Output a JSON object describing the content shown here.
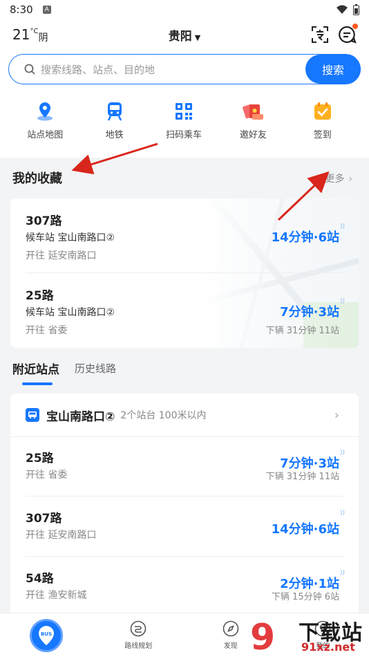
{
  "status": {
    "time": "8:30",
    "notif_glyph": "A"
  },
  "header": {
    "temp": "21",
    "unit": "°C",
    "condition": "阴",
    "city": "贵阳",
    "city_caret": "▼"
  },
  "search": {
    "placeholder": "搜索线路、站点、目的地",
    "button": "搜索"
  },
  "quick": [
    {
      "label": "站点地图",
      "icon": "map-pin-icon"
    },
    {
      "label": "地铁",
      "icon": "metro-icon"
    },
    {
      "label": "扫码乘车",
      "icon": "qr-code-icon"
    },
    {
      "label": "邀好友",
      "icon": "red-envelope-icon"
    },
    {
      "label": "签到",
      "icon": "checkin-icon"
    }
  ],
  "favorites": {
    "title": "我的收藏",
    "more": "更多",
    "more_chev": "›",
    "items": [
      {
        "route": "307路",
        "stop": "候车站 宝山南路口②",
        "direction": "开往 延安南路口",
        "eta": "14分钟·6站",
        "sub": ""
      },
      {
        "route": "25路",
        "stop": "候车站 宝山南路口②",
        "direction": "开往 省委",
        "eta": "7分钟·3站",
        "sub": "下辆  31分钟 11站"
      }
    ]
  },
  "tabs": {
    "nearby": "附近站点",
    "history": "历史线路"
  },
  "nearby": {
    "stop_name": "宝山南路口②",
    "stop_info": "2个站台 100米以内",
    "chev": "›",
    "rows": [
      {
        "route": "25路",
        "direction": "开往 省委",
        "eta": "7分钟·3站",
        "sub": "下辆  31分钟 11站"
      },
      {
        "route": "307路",
        "direction": "开往 延安南路口",
        "eta": "14分钟·6站",
        "sub": ""
      },
      {
        "route": "54路",
        "direction": "开往 渔安新城",
        "eta": "2分钟·1站",
        "sub": "下辆  15分钟 6站"
      }
    ]
  },
  "tabbar": {
    "home_badge": "BUS",
    "route_plan": "路线规划",
    "discover": "发现",
    "mine": "我的"
  },
  "watermark": {
    "text": "下载站",
    "domain": "91xz.net"
  },
  "colors": {
    "accent": "#1677ff",
    "annotation": "#d9261c"
  }
}
